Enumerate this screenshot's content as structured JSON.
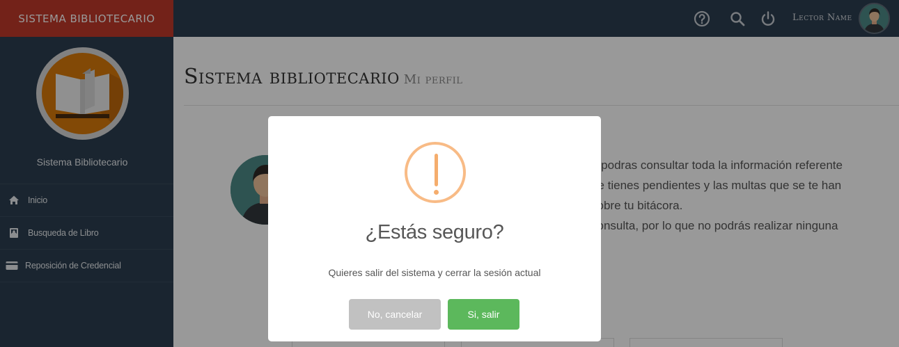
{
  "brand": {
    "title": "SISTEMA BIBLIOTECARIO",
    "color": "#c0392b"
  },
  "topbar": {
    "icons": [
      "help-circle-icon",
      "search-icon",
      "power-icon"
    ],
    "user_name": "Lector Name"
  },
  "sidebar": {
    "title": "Sistema Bibliotecario",
    "items": [
      {
        "label": "Inicio",
        "icon": "home-icon"
      },
      {
        "label": "Busqueda de Libro",
        "icon": "book-search-icon"
      },
      {
        "label": "Reposición de Credencial",
        "icon": "credit-card-icon"
      }
    ]
  },
  "main": {
    "title": "Sistema bibliotecario",
    "subtitle": "Mi perfil",
    "profile_lines": [
      "n podras consultar toda la información referente",
      "ue tienes pendientes y las multas que se te han",
      "sobre tu bitácora.",
      "consulta, por lo que no podrás realizar ninguna"
    ]
  },
  "modal": {
    "title": "¿Estás seguro?",
    "text": "Quieres salir del sistema y cerrar la sesión actual",
    "cancel_label": "No, cancelar",
    "confirm_label": "Si, salir",
    "icon": "warning-icon",
    "warning_color": "#f8bb86",
    "confirm_color": "#5cb85c",
    "cancel_color": "#c1c1c1"
  }
}
